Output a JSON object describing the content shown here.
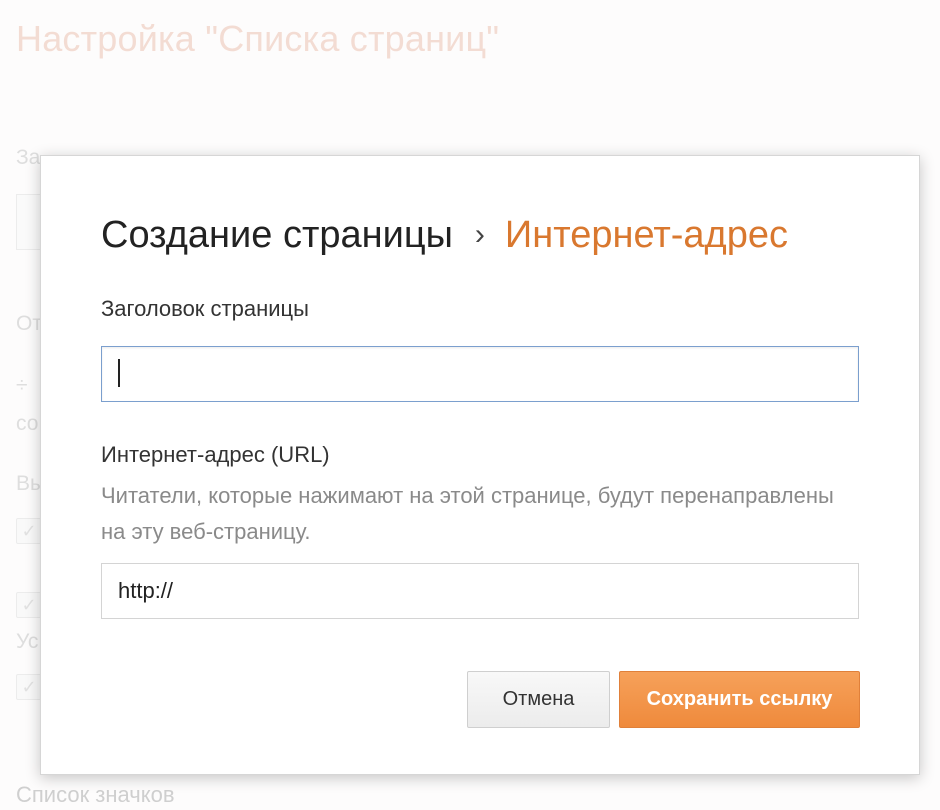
{
  "background": {
    "title": "Настройка \"Списка страниц\"",
    "labels": [
      "За",
      "От",
      "со",
      "Вы",
      "Ус"
    ],
    "divide_icon": "÷",
    "check_icon": "✓",
    "bottom_label": "Список значков"
  },
  "dialog": {
    "heading": {
      "current_step": "Создание страницы",
      "separator": "›",
      "next_step": "Интернет-адрес"
    },
    "title_field": {
      "label": "Заголовок страницы",
      "value": ""
    },
    "url_field": {
      "label": "Интернет-адрес (URL)",
      "help": "Читатели, которые нажимают на этой странице, будут перенаправлены на эту веб-страницу.",
      "value": "http://"
    },
    "buttons": {
      "cancel": "Отмена",
      "save": "Сохранить ссылку"
    }
  },
  "colors": {
    "accent": "#ef8a3c",
    "next_step_text": "#d9782f",
    "input_focus_border": "#7b9fce"
  }
}
